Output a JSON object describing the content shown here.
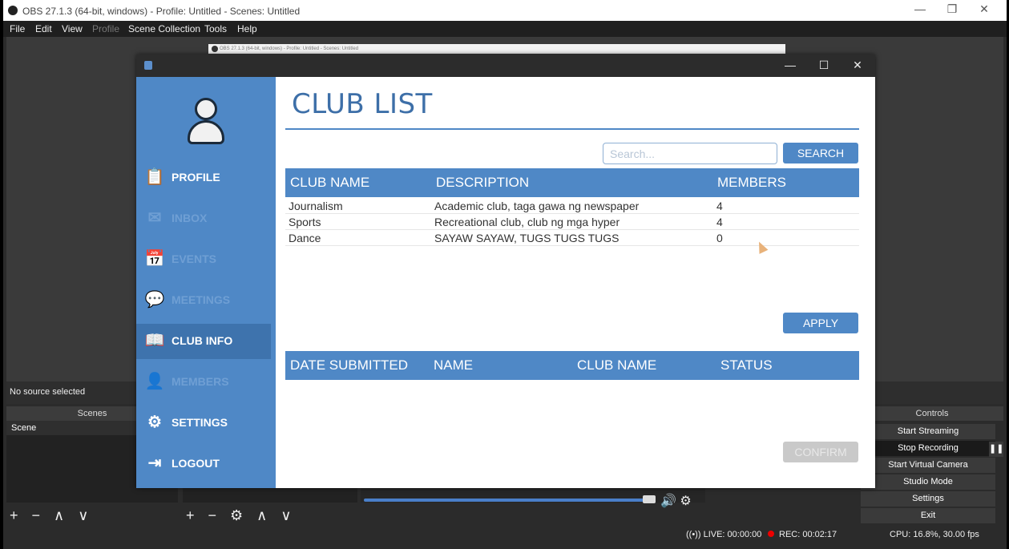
{
  "obs": {
    "title": "OBS 27.1.3 (64-bit, windows) - Profile: Untitled - Scenes: Untitled",
    "window_controls": [
      "—",
      "❐",
      "✕"
    ],
    "menu": [
      "File",
      "Edit",
      "View",
      "Profile",
      "Scene Collection",
      "Tools",
      "Help"
    ],
    "no_source": "No source selected",
    "scenes_header": "Scenes",
    "scene_item": "Scene",
    "controls_header": "Controls",
    "controls": [
      "Start Streaming",
      "Stop Recording",
      "Start Virtual Camera",
      "Studio Mode",
      "Settings",
      "Exit"
    ],
    "pause": "❚❚",
    "toolbar_scenes": "+ − ∧ ∨",
    "toolbar_sources": "+ − ⚙ ∧ ∨",
    "mixer_icons": "🔊 ⚙",
    "status": {
      "live": "LIVE: 00:00:00",
      "rec": "REC: 00:02:17",
      "cpu": "CPU: 16.8%, 30.00 fps"
    }
  },
  "app": {
    "window_controls": [
      "—",
      "☐",
      "✕"
    ],
    "nav": [
      {
        "label": "PROFILE",
        "icon": "📋"
      },
      {
        "label": "INBOX",
        "icon": "✉"
      },
      {
        "label": "EVENTS",
        "icon": "📅"
      },
      {
        "label": "MEETINGS",
        "icon": "💬"
      },
      {
        "label": "CLUB INFO",
        "icon": "📖"
      },
      {
        "label": "MEMBERS",
        "icon": "👤"
      },
      {
        "label": "SETTINGS",
        "icon": "⚙"
      },
      {
        "label": "LOGOUT",
        "icon": "⇥"
      }
    ],
    "page_title": "CLUB LIST",
    "search_placeholder": "Search...",
    "search_button": "SEARCH",
    "club_table": {
      "headers": [
        "CLUB NAME",
        "DESCRIPTION",
        "MEMBERS"
      ],
      "rows": [
        [
          "Journalism",
          "Academic club, taga gawa ng newspaper",
          "4"
        ],
        [
          "Sports",
          "Recreational club, club ng mga hyper",
          "4"
        ],
        [
          "Dance",
          "SAYAW SAYAW, TUGS TUGS TUGS",
          "0"
        ]
      ]
    },
    "apply_button": "APPLY",
    "applications_table": {
      "headers": [
        "DATE SUBMITTED",
        "NAME",
        "CLUB NAME",
        "STATUS"
      ]
    },
    "confirm_button": "CONFIRM"
  }
}
